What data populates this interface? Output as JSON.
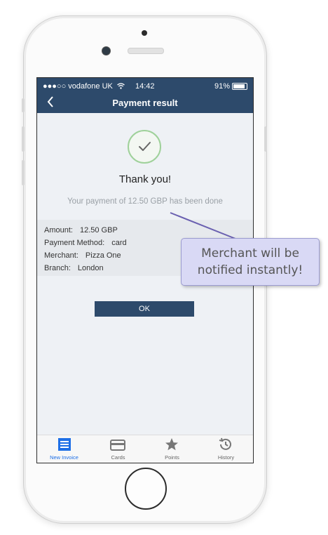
{
  "status_bar": {
    "carrier": "●●●○○ vodafone UK",
    "time": "14:42",
    "battery": "91%"
  },
  "nav": {
    "title": "Payment  result",
    "back_icon": "chevron-left-icon"
  },
  "result": {
    "icon": "check-icon",
    "title": "Thank you!",
    "subtitle": "Your payment of 12.50 GBP has been done"
  },
  "details": [
    {
      "label": "Amount:",
      "value": "12.50 GBP"
    },
    {
      "label": "Payment Method:",
      "value": "card"
    },
    {
      "label": "Merchant:",
      "value": "Pizza One"
    },
    {
      "label": "Branch:",
      "value": "London"
    }
  ],
  "ok_button": "OK",
  "tabs": [
    {
      "label": "New Invoice",
      "icon": "invoice-icon",
      "active": true
    },
    {
      "label": "Cards",
      "icon": "card-icon",
      "active": false
    },
    {
      "label": "Points",
      "icon": "star-icon",
      "active": false
    },
    {
      "label": "History",
      "icon": "history-icon",
      "active": false
    }
  ],
  "callout": {
    "line1": "Merchant will be",
    "line2": "notified instantly!"
  },
  "colors": {
    "header": "#2d4a6b",
    "accent": "#1e6fe6",
    "success": "#8fcf88",
    "callout_bg": "#d9d9f5"
  }
}
